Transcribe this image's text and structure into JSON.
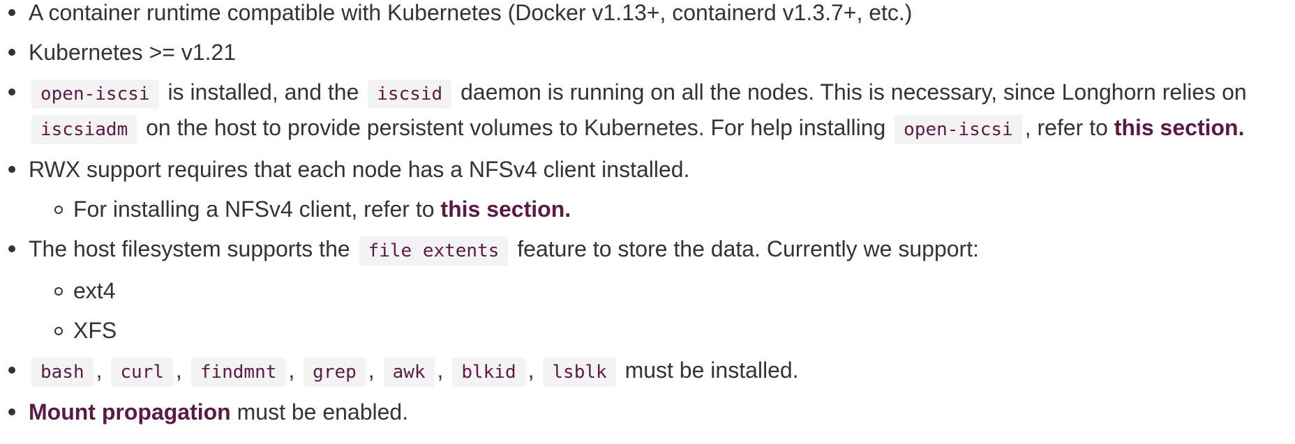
{
  "requirements": {
    "item1": "A container runtime compatible with Kubernetes (Docker v1.13+, containerd v1.3.7+, etc.)",
    "item2": "Kubernetes >= v1.21",
    "item3": {
      "code1": "open-iscsi",
      "text1": " is installed, and the ",
      "code2": "iscsid",
      "text2": " daemon is running on all the nodes. This is necessary, since Longhorn relies on ",
      "code3": "iscsiadm",
      "text3": " on the host to provide persistent volumes to Kubernetes. For help installing ",
      "code4": "open-iscsi",
      "text4": ", refer to ",
      "link": "this section."
    },
    "item4": {
      "text": "RWX support requires that each node has a NFSv4 client installed.",
      "sub1": {
        "text": "For installing a NFSv4 client, refer to ",
        "link": "this section."
      }
    },
    "item5": {
      "text1": "The host filesystem supports the ",
      "code": "file extents",
      "text2": " feature to store the data. Currently we support:",
      "sub": [
        "ext4",
        "XFS"
      ]
    },
    "item6": {
      "tools": [
        "bash",
        "curl",
        "findmnt",
        "grep",
        "awk",
        "blkid",
        "lsblk"
      ],
      "separator": ",",
      "text": " must be installed."
    },
    "item7": {
      "link": "Mount propagation",
      "text": " must be enabled."
    }
  }
}
